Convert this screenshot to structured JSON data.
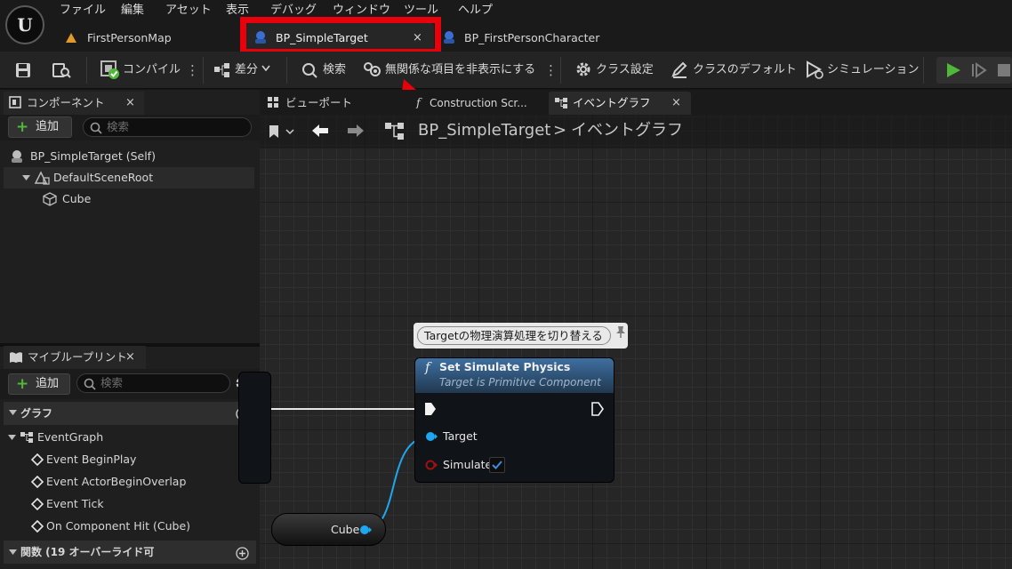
{
  "app": {
    "logo": "U"
  },
  "menu": [
    "ファイル",
    "編集",
    "アセット",
    "表示",
    "デバッグ",
    "ウィンドウ",
    "ツール",
    "ヘルプ"
  ],
  "document_tabs": [
    {
      "label": "FirstPersonMap",
      "icon": "level-icon",
      "active": false
    },
    {
      "label": "BP_SimpleTarget",
      "icon": "blueprint-icon",
      "active": true,
      "close": "×"
    },
    {
      "label": "BP_FirstPersonCharacter",
      "icon": "blueprint-icon",
      "active": false
    }
  ],
  "toolbar": {
    "compile": "コンパイル",
    "diff": "差分",
    "search": "検索",
    "hide_unrelated": "無関係な項目を非表示にする",
    "class_settings": "クラス設定",
    "class_defaults": "クラスのデフォルト",
    "simulation": "シミュレーション",
    "more": "⋮"
  },
  "components_panel": {
    "title": "コンポーネント",
    "close": "×",
    "add": "追加",
    "search_placeholder": "検索",
    "tree": [
      "BP_SimpleTarget (Self)",
      "DefaultSceneRoot",
      "Cube"
    ]
  },
  "my_blueprint_panel": {
    "title": "マイブループリント",
    "close": "×",
    "add": "追加",
    "search_placeholder": "検索",
    "graph_section": "グラフ",
    "event_graph": "EventGraph",
    "events": [
      "Event BeginPlay",
      "Event ActorBeginOverlap",
      "Event Tick",
      "On Component Hit (Cube)"
    ],
    "functions_section": "関数 (19 オーバーライド可"
  },
  "graph_tabs": [
    {
      "label": "ビューポート",
      "active": false
    },
    {
      "label": "Construction Scr...",
      "active": false
    },
    {
      "label": "イベントグラフ",
      "active": true,
      "close": "×"
    }
  ],
  "breadcrumb": {
    "blueprint": "BP_SimpleTarget",
    "separator": ">",
    "graph": "イベントグラフ"
  },
  "comment_bubble": "Targetの物理演算処理を切り替える",
  "set_node": {
    "icon": "f",
    "title": "Set Simulate Physics",
    "subtitle": "Target is Primitive Component",
    "pins": {
      "target": "Target",
      "simulate": "Simulate"
    },
    "simulate_checked": true
  },
  "cube_node": {
    "label": "Cube"
  },
  "colors": {
    "highlight": "#e8000b",
    "object_pin": "#1ea7f0",
    "bool_pin": "#a01010",
    "play": "#4fb83a",
    "node_header": "#3e6fa0"
  }
}
